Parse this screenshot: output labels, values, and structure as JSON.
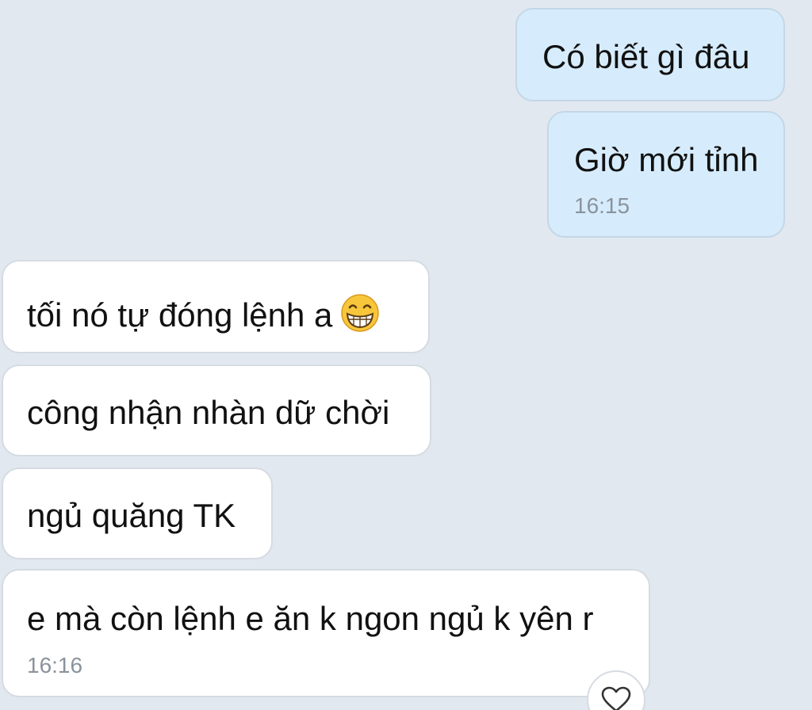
{
  "messages": [
    {
      "id": "m1",
      "direction": "sent",
      "text": "Có biết gì đâu",
      "time": ""
    },
    {
      "id": "m2",
      "direction": "sent",
      "text": "Giờ mới tỉnh",
      "time": "16:15"
    },
    {
      "id": "m3",
      "direction": "received",
      "text": "tối nó tự đóng lệnh a",
      "emoji": "grinning-face-emoji",
      "time": ""
    },
    {
      "id": "m4",
      "direction": "received",
      "text": "công nhận nhàn dữ chời",
      "time": ""
    },
    {
      "id": "m5",
      "direction": "received",
      "text": "ngủ quăng TK",
      "time": ""
    },
    {
      "id": "m6",
      "direction": "received",
      "text": "e mà còn lệnh e ăn k ngon ngủ k yên r",
      "time": "16:16"
    }
  ],
  "reaction": {
    "icon": "heart-icon"
  },
  "colors": {
    "background": "#e2e8f0",
    "sent_bubble": "#d6ecfc",
    "received_bubble": "#ffffff",
    "timestamp": "#8a939c"
  }
}
